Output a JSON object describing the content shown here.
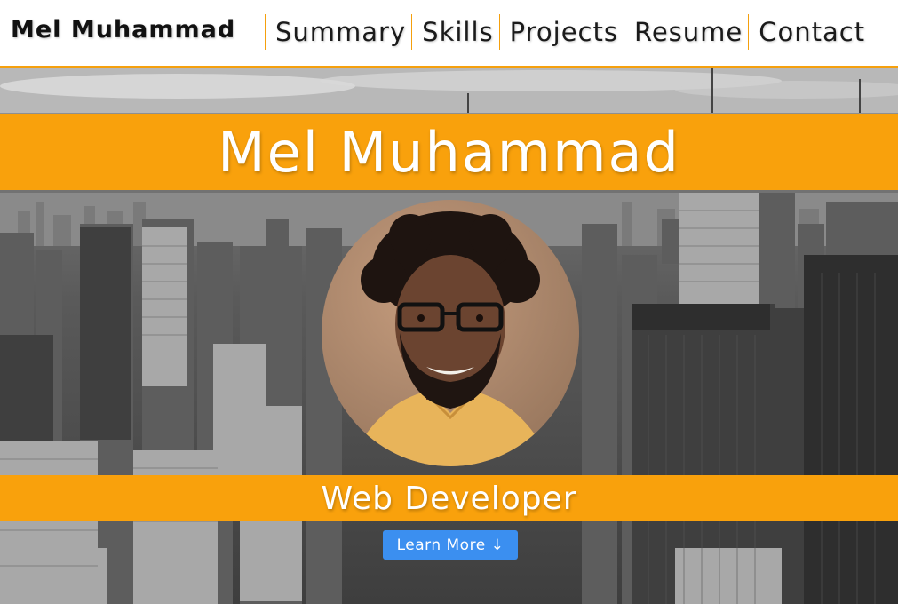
{
  "navbar": {
    "brand": "Mel Muhammad",
    "items": [
      {
        "label": "Summary"
      },
      {
        "label": "Skills"
      },
      {
        "label": "Projects"
      },
      {
        "label": "Resume"
      },
      {
        "label": "Contact"
      }
    ]
  },
  "hero": {
    "name": "Mel Muhammad",
    "role": "Web Developer",
    "cta": {
      "label": "Learn More",
      "arrow": "↓"
    },
    "background": "grayscale-city-skyline"
  },
  "colors": {
    "accent": "#f9a10c",
    "button": "#3b8ff0",
    "text_dark": "#111111",
    "text_light": "#ffffff"
  }
}
